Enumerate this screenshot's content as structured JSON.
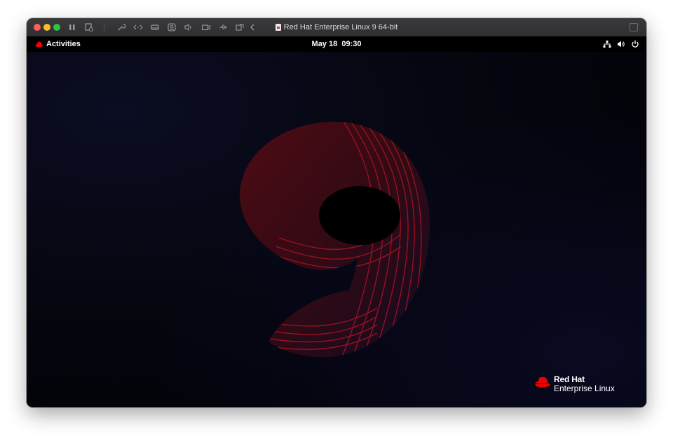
{
  "window": {
    "title": "Red Hat Enterprise Linux 9 64-bit"
  },
  "toolbar": {
    "icons": [
      "pause-icon",
      "snapshot-icon",
      "wrench-icon",
      "code-icon",
      "disk-icon",
      "user-icon",
      "audio-icon",
      "camera-icon",
      "usb-icon",
      "share-icon",
      "back-arrow-icon",
      "restore-window-icon"
    ]
  },
  "topbar": {
    "activities": "Activities",
    "clock": "May 18  09:30",
    "tray": [
      "network-icon",
      "volume-icon",
      "power-icon"
    ]
  },
  "brand": {
    "name": "Red Hat",
    "product": "Enterprise Linux"
  },
  "colors": {
    "accent_red": "#ee0000",
    "topbar": "#000000",
    "desktop": "#04050c"
  }
}
